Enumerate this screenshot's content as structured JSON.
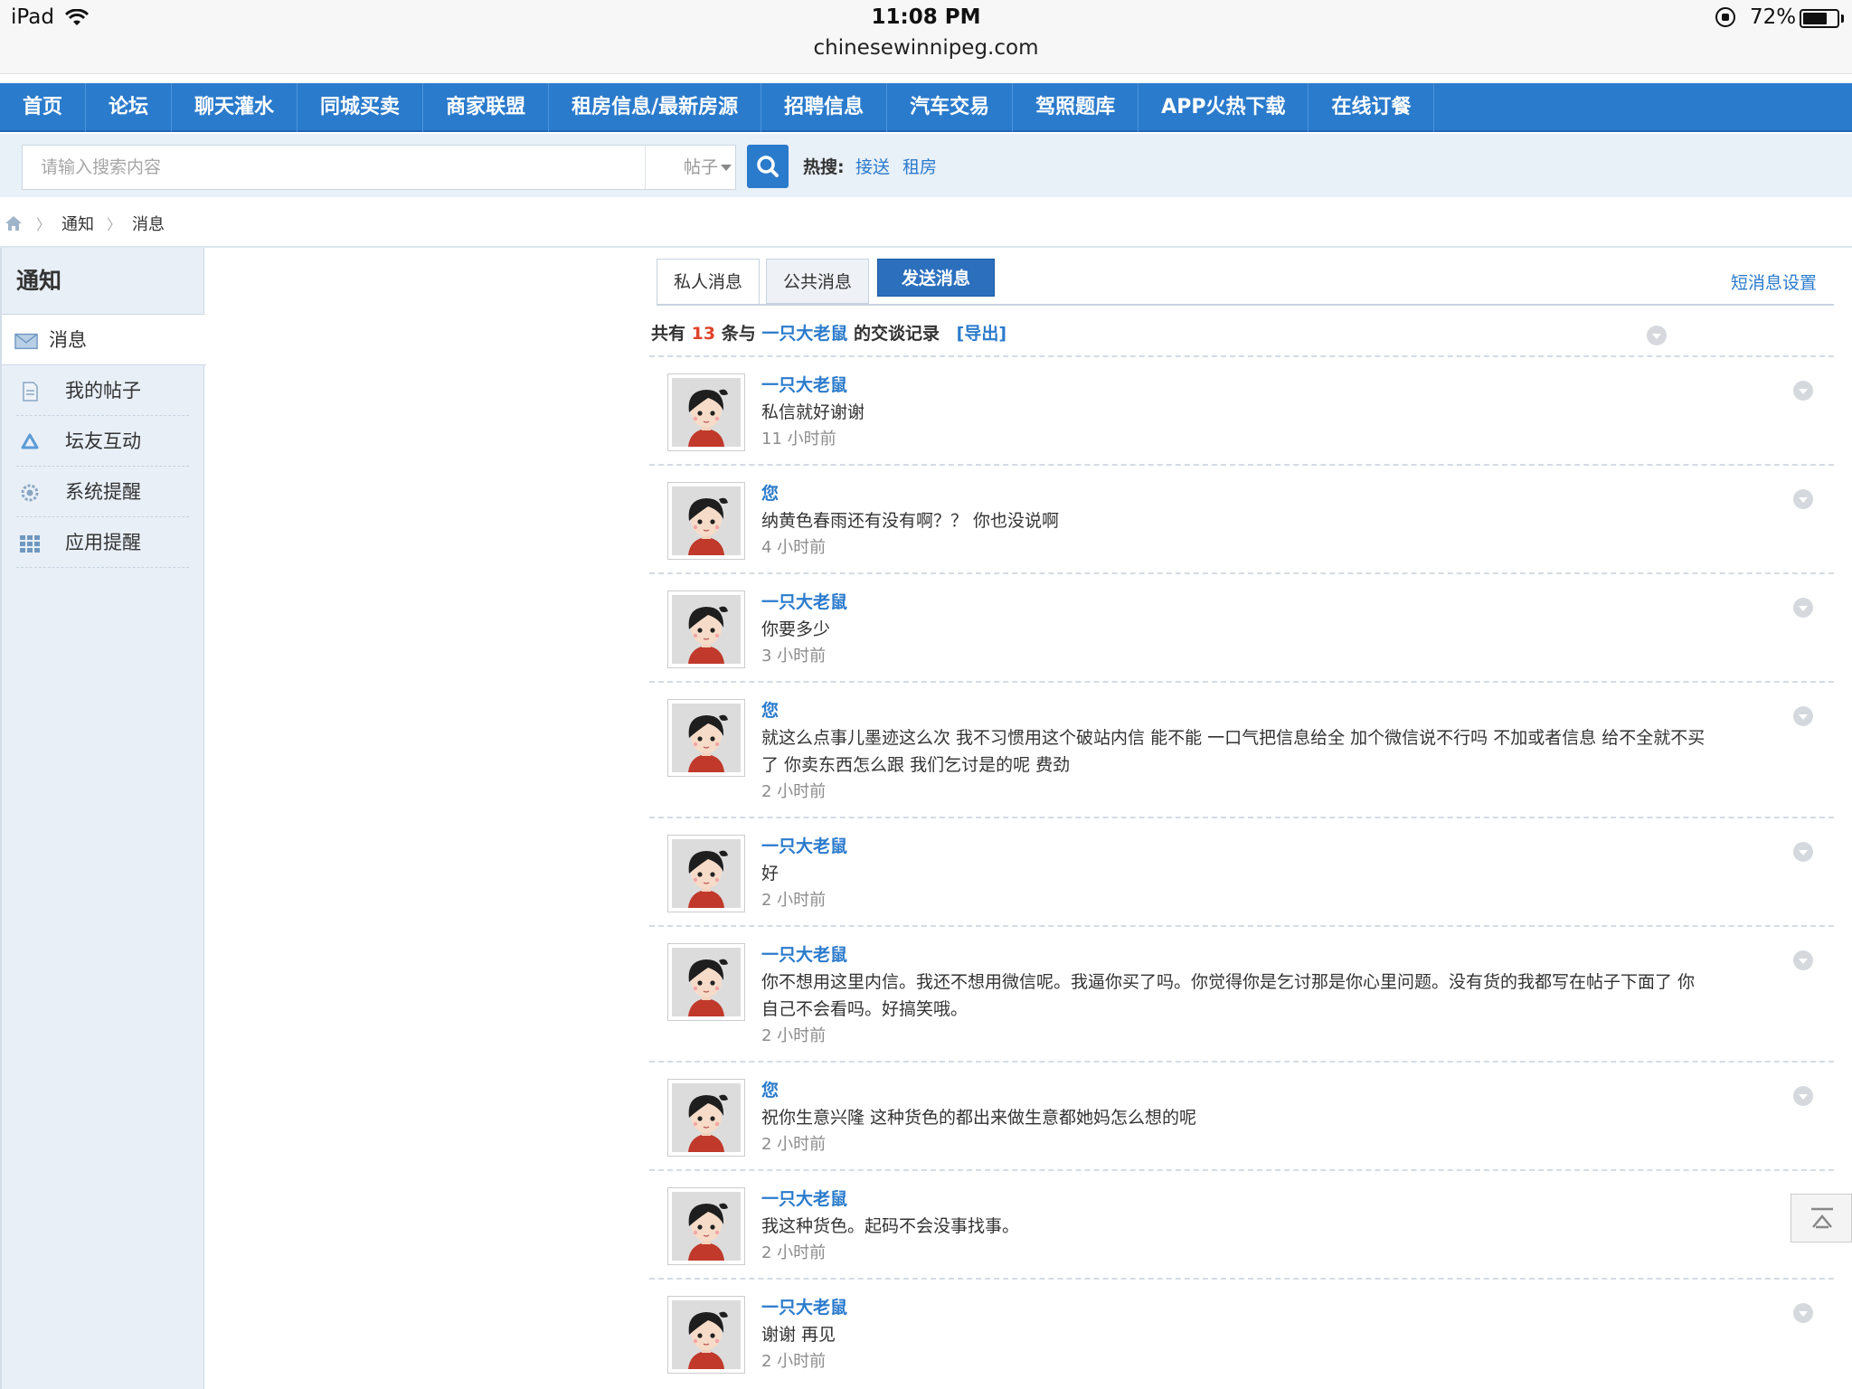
{
  "status_bar": {
    "device": "iPad",
    "time": "11:08 PM",
    "url": "chinesewinnipeg.com",
    "battery_percent": "72%",
    "battery_level": 0.72
  },
  "nav": {
    "items": [
      "首页",
      "论坛",
      "聊天灌水",
      "同城买卖",
      "商家联盟",
      "租房信息/最新房源",
      "招聘信息",
      "汽车交易",
      "驾照题库",
      "APP火热下载",
      "在线订餐"
    ]
  },
  "search": {
    "placeholder": "请输入搜索内容",
    "type": "帖子",
    "hot_label": "热搜:",
    "hot_links": [
      "接送",
      "租房"
    ]
  },
  "breadcrumb": {
    "items": [
      "通知",
      "消息"
    ]
  },
  "sidebar": {
    "title": "通知",
    "items": [
      {
        "label": "消息",
        "icon": "envelope-icon"
      },
      {
        "label": "我的帖子",
        "icon": "document-icon"
      },
      {
        "label": "坛友互动",
        "icon": "recycle-icon"
      },
      {
        "label": "系统提醒",
        "icon": "gear-icon"
      },
      {
        "label": "应用提醒",
        "icon": "grid-icon"
      }
    ]
  },
  "tabs": {
    "private": "私人消息",
    "public": "公共消息",
    "send": "发送消息",
    "settings": "短消息设置"
  },
  "summary": {
    "prefix": "共有",
    "count": "13",
    "middle": "条与",
    "partner": "一只大老鼠",
    "suffix": "的交谈记录",
    "export": "[导出]"
  },
  "messages": [
    {
      "author": "一只大老鼠",
      "text": "私信就好谢谢",
      "time": "11 小时前"
    },
    {
      "author": "您",
      "text": "纳黄色春雨还有没有啊？？ 你也没说啊",
      "time": "4 小时前"
    },
    {
      "author": "一只大老鼠",
      "text": "你要多少",
      "time": "3 小时前"
    },
    {
      "author": "您",
      "text": "就这么点事儿墨迹这么次 我不习惯用这个破站内信 能不能 一口气把信息给全 加个微信说不行吗 不加或者信息 给不全就不买了 你卖东西怎么跟 我们乞讨是的呢 费劲",
      "time": "2 小时前"
    },
    {
      "author": "一只大老鼠",
      "text": "好",
      "time": "2 小时前"
    },
    {
      "author": "一只大老鼠",
      "text": "你不想用这里内信。我还不想用微信呢。我逼你买了吗。你觉得你是乞讨那是你心里问题。没有货的我都写在帖子下面了 你自己不会看吗。好搞笑哦。",
      "time": "2 小时前"
    },
    {
      "author": "您",
      "text": "祝你生意兴隆 这种货色的都出来做生意都她妈怎么想的呢",
      "time": "2 小时前"
    },
    {
      "author": "一只大老鼠",
      "text": "我这种货色。起码不会没事找事。",
      "time": "2 小时前"
    },
    {
      "author": "一只大老鼠",
      "text": "谢谢 再见",
      "time": "2 小时前"
    }
  ]
}
